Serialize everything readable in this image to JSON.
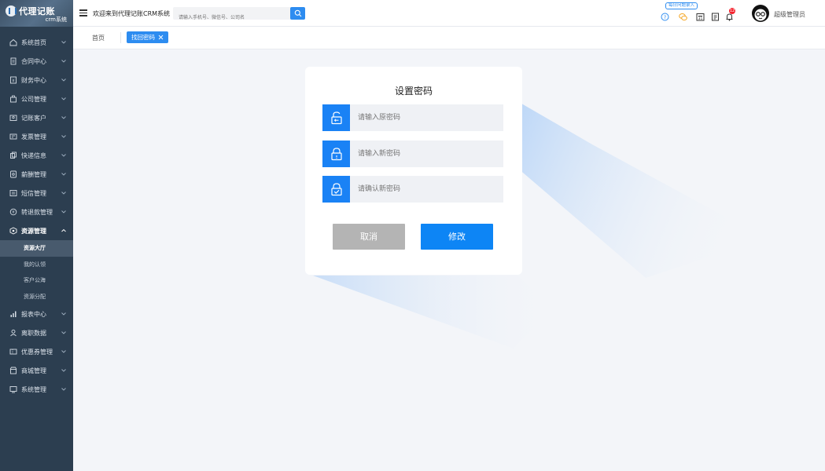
{
  "brand": {
    "title": "代理记账",
    "subtitle": "crm系统"
  },
  "sidebar": {
    "items": [
      {
        "label": "系统首页",
        "icon": "home-icon"
      },
      {
        "label": "合同中心",
        "icon": "contract-icon"
      },
      {
        "label": "财务中心",
        "icon": "finance-icon"
      },
      {
        "label": "公司管理",
        "icon": "company-icon"
      },
      {
        "label": "记账客户",
        "icon": "customer-icon"
      },
      {
        "label": "发票管理",
        "icon": "invoice-icon"
      },
      {
        "label": "快递信息",
        "icon": "express-icon"
      },
      {
        "label": "薪酬管理",
        "icon": "salary-icon"
      },
      {
        "label": "短信管理",
        "icon": "sms-icon"
      },
      {
        "label": "转退款管理",
        "icon": "refund-icon"
      },
      {
        "label": "资源管理",
        "icon": "resource-icon",
        "open": true
      },
      {
        "label": "报表中心",
        "icon": "report-icon"
      },
      {
        "label": "离职数据",
        "icon": "resign-icon"
      },
      {
        "label": "优惠券管理",
        "icon": "coupon-icon"
      },
      {
        "label": "商城管理",
        "icon": "mall-icon"
      },
      {
        "label": "系统管理",
        "icon": "system-icon"
      }
    ],
    "subitems": [
      {
        "label": "资源大厅",
        "active": true
      },
      {
        "label": "我的认领"
      },
      {
        "label": "客户公海"
      },
      {
        "label": "资源分配"
      }
    ]
  },
  "header": {
    "welcome": "欢迎来到代理记账CRM系统",
    "search_placeholder": "请输入手机号、微信号、公司名",
    "daily_badge": "每日问题录入",
    "notify_count": "12",
    "user_name": "超级管理员"
  },
  "tabs": {
    "home": "首页",
    "active": "找回密码"
  },
  "form": {
    "title": "设置密码",
    "old_placeholder": "请输入原密码",
    "new_placeholder": "请输入新密码",
    "confirm_placeholder": "请确认新密码",
    "cancel_label": "取消",
    "submit_label": "修改"
  },
  "colors": {
    "primary": "#1a82f5",
    "sidebar": "#2c3e50",
    "cancel": "#b4b4b4"
  }
}
